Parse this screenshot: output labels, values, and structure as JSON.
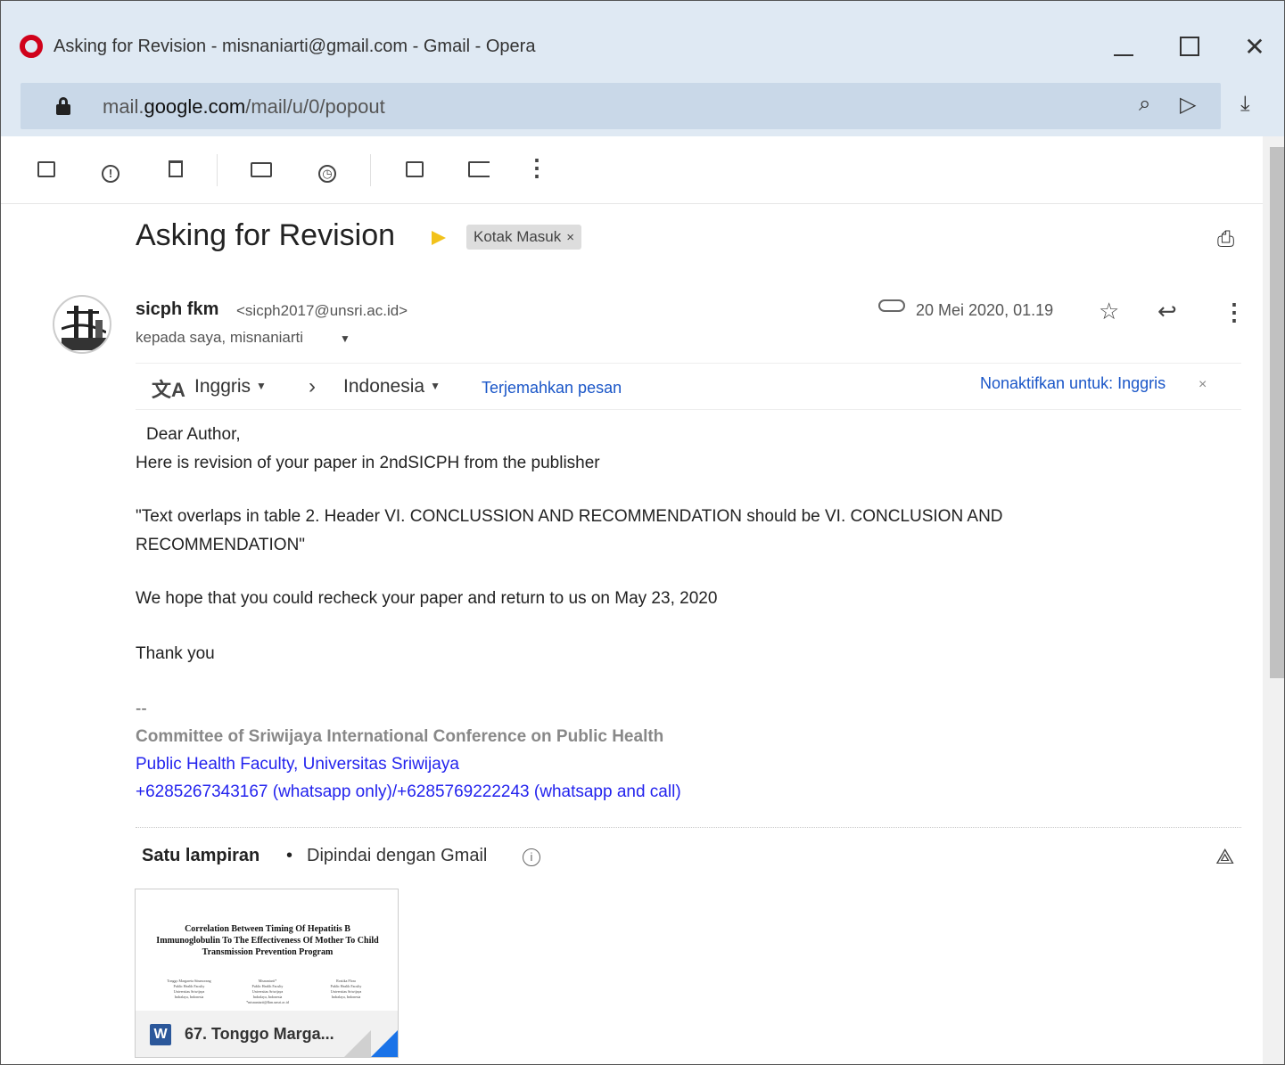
{
  "window": {
    "title": "Asking for Revision - misnaniarti@gmail.com - Gmail - Opera"
  },
  "address": {
    "url_prefix": "mail.",
    "url_domain": "google.com",
    "url_path": "/mail/u/0/popout"
  },
  "toolbar": {
    "more": "⋮"
  },
  "email": {
    "subject": "Asking for Revision",
    "label": "Kotak Masuk",
    "label_remove": "×",
    "sender_name": "sicph fkm",
    "sender_email": "<sicph2017@unsri.ac.id>",
    "recipients": "kepada saya, misnaniarti",
    "date": "20 Mei 2020, 01.19"
  },
  "translate": {
    "from_lang": "Inggris",
    "to_lang": "Indonesia",
    "translate_link": "Terjemahkan pesan",
    "disable_link": "Nonaktifkan untuk: Inggris",
    "disable_close": "×"
  },
  "body": {
    "greeting": "Dear Author,",
    "line1": "Here is revision of your paper in 2ndSICPH from the publisher",
    "quote_line1": "\"Text overlaps in table 2. Header VI. CONCLUSSION AND RECOMMENDATION should be VI. CONCLUSION AND",
    "quote_line2": "RECOMMENDATION\"",
    "line2": "We hope that you could recheck your paper and return to us on May 23, 2020",
    "thanks": "Thank you",
    "sig_separator": "--",
    "sig_org": "Committee of Sriwijaya International Conference on Public Health",
    "sig_faculty": "Public Health Faculty, Universitas Sriwijaya",
    "sig_phone": "+6285267343167 (whatsapp only)/+6285769222243 (whatsapp and call)"
  },
  "attachments": {
    "count_label": "Satu lampiran",
    "bullet": "•",
    "scan_label": "Dipindai dengan Gmail",
    "info": "i",
    "file_badge": "W",
    "file_name": "67. Tonggo Marga...",
    "preview_title": "Correlation Between Timing Of Hepatitis B Immunoglobulin To The Effectiveness Of Mother To Child Transmission Prevention Program",
    "preview_authors": [
      {
        "name": "Tonggo Margareta Situmorang",
        "line2": "Public Health Faculty",
        "line3": "Universitas Sriwijaya",
        "line4": "Indralaya, Indonesia"
      },
      {
        "name": "Misnaniarti*",
        "line2": "Public Health Faculty",
        "line3": "Universitas Sriwijaya",
        "line4": "Indralaya, Indonesia"
      },
      {
        "name": "Rostika Flora",
        "line2": "Public Health Faculty",
        "line3": "Universitas Sriwijaya",
        "line4": "Indralaya, Indonesia"
      }
    ],
    "preview_email": "*misnaniarti@fkm.unsri.ac.id"
  }
}
